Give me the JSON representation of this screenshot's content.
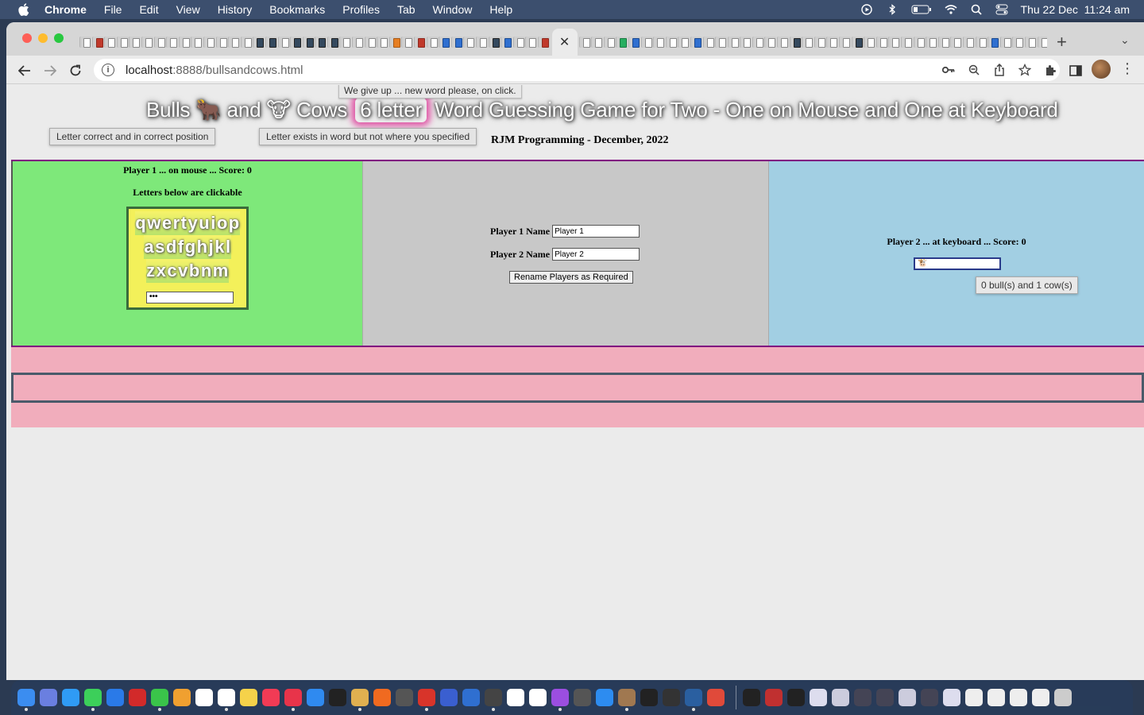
{
  "menubar": {
    "app": "Chrome",
    "items": [
      "File",
      "Edit",
      "View",
      "History",
      "Bookmarks",
      "Profiles",
      "Tab",
      "Window",
      "Help"
    ],
    "clock": "Thu 22 Dec  11:24 am"
  },
  "browser": {
    "url_host": "localhost",
    "url_path": ":8888/bullsandcows.html",
    "active_tab_close": "✕",
    "new_tab": "+",
    "tab_menu": "⌄"
  },
  "page": {
    "tooltip_giveup": "We give up ... new word please, on click.",
    "title_pre": "Bulls 🐂 and 🐮 Cows",
    "title_count": "6 letter",
    "title_post": "Word Guessing Game for Two - One on Mouse and One at Keyboard",
    "hint_correct": "Letter correct and in correct position",
    "hint_exists": "Letter exists in word but not where you specified",
    "author": "RJM Programming - December, 2022",
    "player1": {
      "heading": "Player 1 ... on mouse ... Score: 0",
      "subheading": "Letters below are clickable",
      "rows": [
        "qwertyuiop",
        "asdfghjkl",
        "zxcvbnm"
      ],
      "input_value": "•••"
    },
    "names": {
      "p1_label": "Player 1 Name",
      "p1_value": "Player 1",
      "p2_label": "Player 2 Name",
      "p2_value": "Player 2",
      "rename_button": "Rename Players as Required"
    },
    "player2": {
      "heading": "Player 2 ... at keyboard ... Score: 0",
      "guess_value": "🐮",
      "result": "0 bull(s) and 1 cow(s)"
    }
  },
  "colors": {
    "player1_bg": "#7ee87a",
    "names_bg": "#c8c8c8",
    "player2_bg": "#a2cfe3",
    "pink_band": "#f1adbc",
    "keyboard_bg": "#f3f05a"
  }
}
